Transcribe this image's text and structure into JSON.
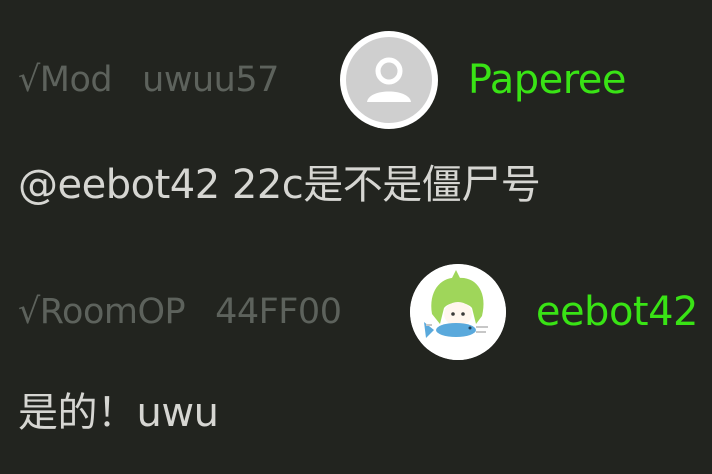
{
  "messages": [
    {
      "role": "√Mod",
      "color_code": "uwuu57",
      "username": "Paperee",
      "avatar": "default-user-icon",
      "text": "@eebot42 22c是不是僵尸号"
    },
    {
      "role": "√RoomOP",
      "color_code": "44FF00",
      "username": "eebot42",
      "avatar": "anime-character-with-fish-icon",
      "text": "是的！uwu"
    }
  ],
  "colors": {
    "background": "#22241f",
    "username": "#39e315",
    "meta": "#5d625c",
    "body": "#d6d6d2"
  }
}
